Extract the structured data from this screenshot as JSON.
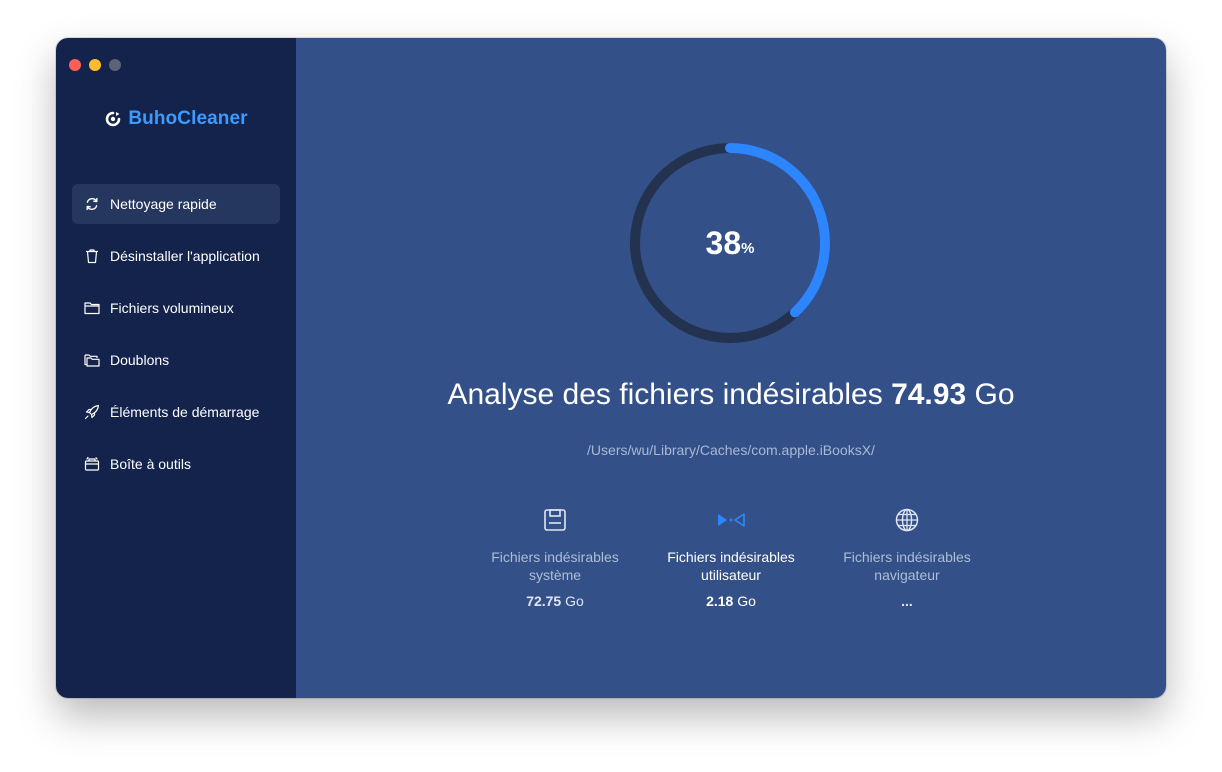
{
  "app": {
    "brand": "BuhoCleaner"
  },
  "colors": {
    "sidebar": "#13234b",
    "main": "#335188",
    "accent": "#2e86ff",
    "ring_track": "#22324f"
  },
  "sidebar": {
    "items": [
      {
        "label": "Nettoyage rapide",
        "icon": "refresh-icon",
        "active": true
      },
      {
        "label": "Désinstaller l'application",
        "icon": "trash-icon",
        "active": false
      },
      {
        "label": "Fichiers volumineux",
        "icon": "folder-icon",
        "active": false
      },
      {
        "label": "Doublons",
        "icon": "duplicate-folder-icon",
        "active": false
      },
      {
        "label": "Éléments de démarrage",
        "icon": "rocket-icon",
        "active": false
      },
      {
        "label": "Boîte à outils",
        "icon": "toolbox-icon",
        "active": false
      }
    ]
  },
  "progress": {
    "value": 38,
    "value_text": "38",
    "unit": "%"
  },
  "scan": {
    "title": "Analyse des fichiers indésirables",
    "size_value": "74.93",
    "size_unit": "Go",
    "current_path": "/Users/wu/Library/Caches/com.apple.iBooksX/"
  },
  "stats": [
    {
      "label_line1": "Fichiers indésirables",
      "label_line2": "système",
      "value": "72.75",
      "unit": "Go",
      "icon": "disk-icon",
      "state": "done"
    },
    {
      "label_line1": "Fichiers indésirables",
      "label_line2": "utilisateur",
      "value": "2.18",
      "unit": "Go",
      "icon": "user-junk-icon",
      "state": "scanning"
    },
    {
      "label_line1": "Fichiers indésirables",
      "label_line2": "navigateur",
      "value": "...",
      "unit": "",
      "icon": "globe-icon",
      "state": "pending"
    }
  ]
}
